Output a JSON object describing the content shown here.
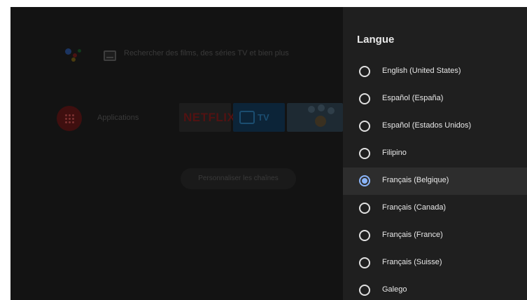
{
  "home": {
    "search_text": "Rechercher des films, des séries TV et bien plus",
    "apps_label": "Applications",
    "netflix_label": "NETFLIX",
    "tv_label": "TV",
    "customize_button": "Personnaliser les chaînes"
  },
  "panel": {
    "title": "Langue",
    "accent_color": "#8ab4f8",
    "items": [
      {
        "label": "English (United States)",
        "checked": false
      },
      {
        "label": "Español (España)",
        "checked": false
      },
      {
        "label": "Español (Estados Unidos)",
        "checked": false
      },
      {
        "label": "Filipino",
        "checked": false
      },
      {
        "label": "Français (Belgique)",
        "checked": true
      },
      {
        "label": "Français (Canada)",
        "checked": false
      },
      {
        "label": "Français (France)",
        "checked": false
      },
      {
        "label": "Français (Suisse)",
        "checked": false
      },
      {
        "label": "Galego",
        "checked": false
      }
    ]
  }
}
